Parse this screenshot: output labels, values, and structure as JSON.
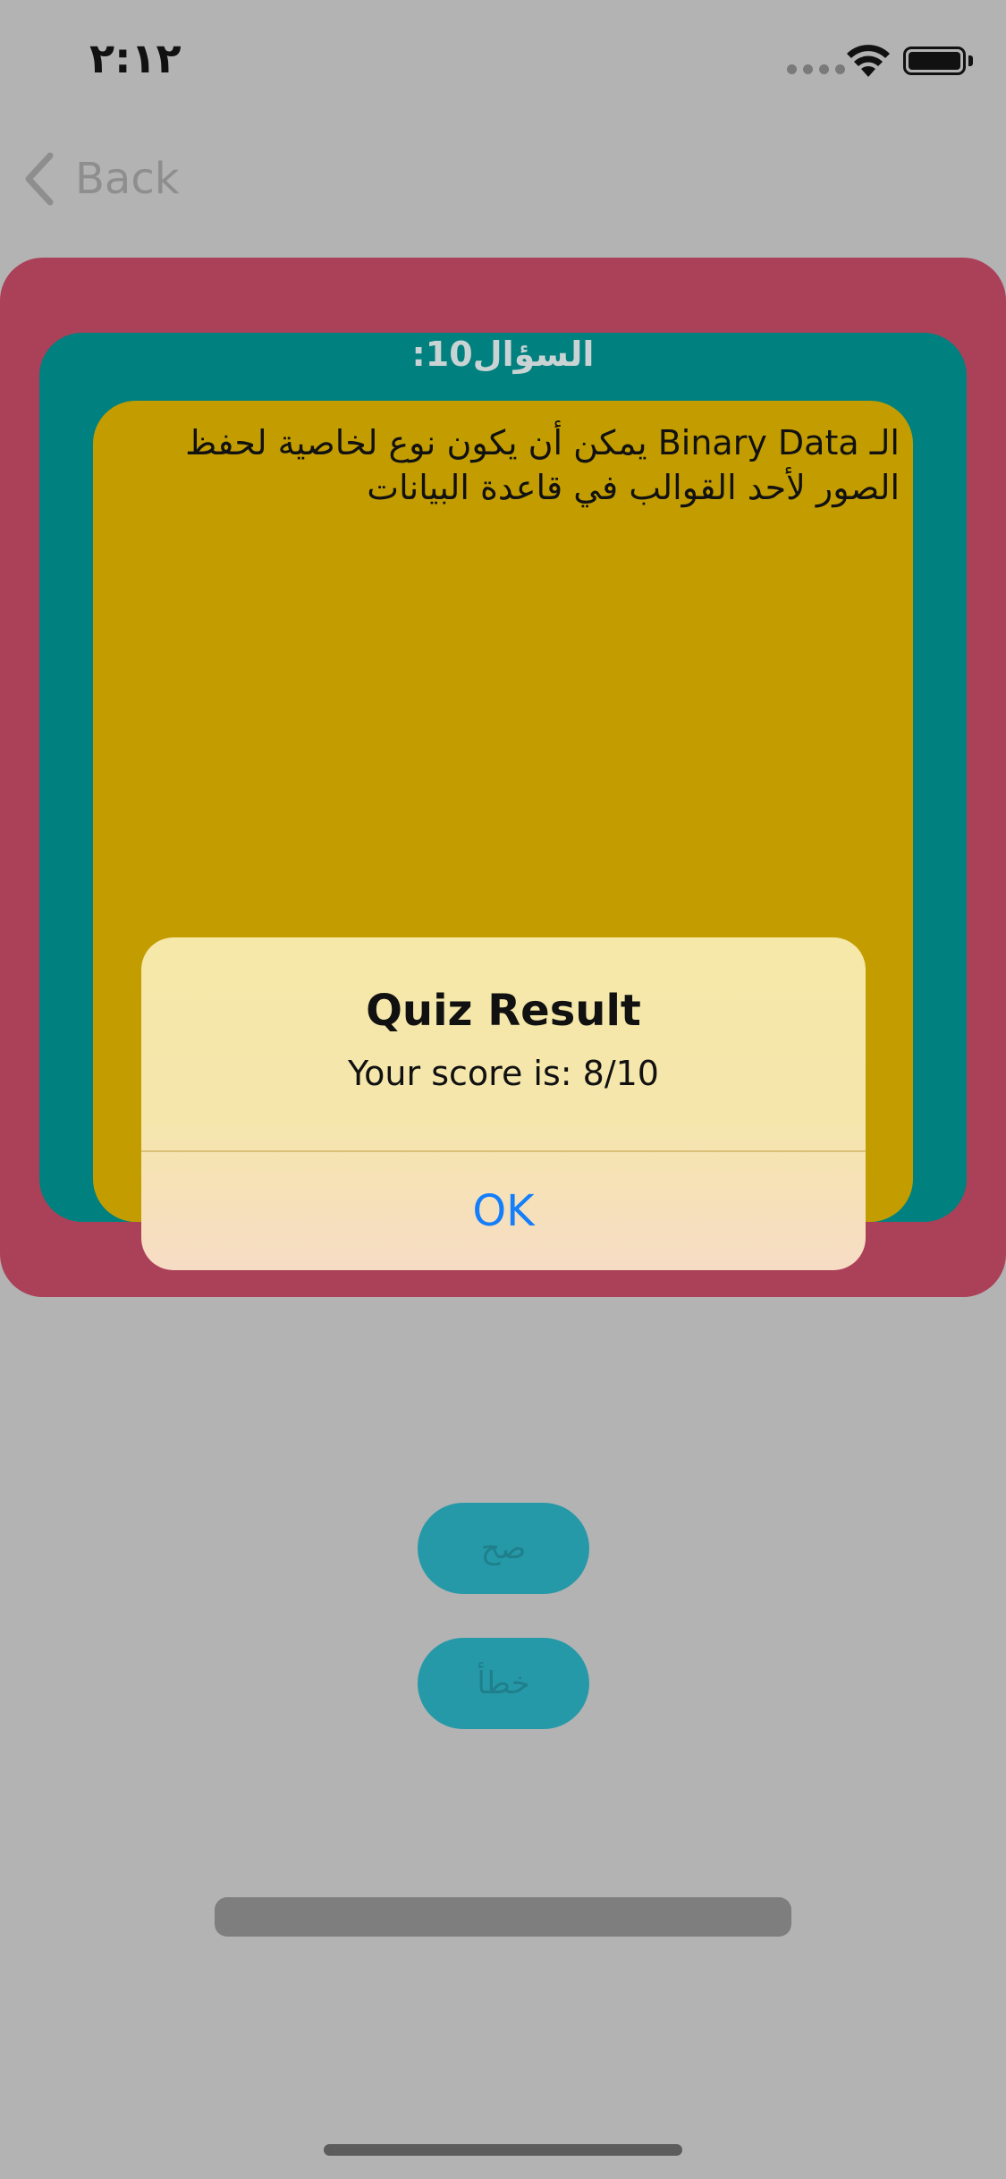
{
  "status_bar": {
    "time": "٢:١٢"
  },
  "nav": {
    "back_label": "Back"
  },
  "quiz": {
    "question_title": "السؤال10:",
    "question_text": "الـ Binary Data يمكن أن يكون نوع لخاصية لحفظ الصور لأحد القوالب في قاعدة البيانات",
    "true_label": "صح",
    "false_label": "خطأ"
  },
  "alert": {
    "title": "Quiz Result",
    "message": "Your score is: 8/10",
    "ok_label": "OK"
  },
  "colors": {
    "outer_card": "#ab4159",
    "middle_card": "#00807f",
    "inner_card": "#c39d00",
    "answer_button": "#2699a8",
    "ok_link": "#147efb"
  }
}
